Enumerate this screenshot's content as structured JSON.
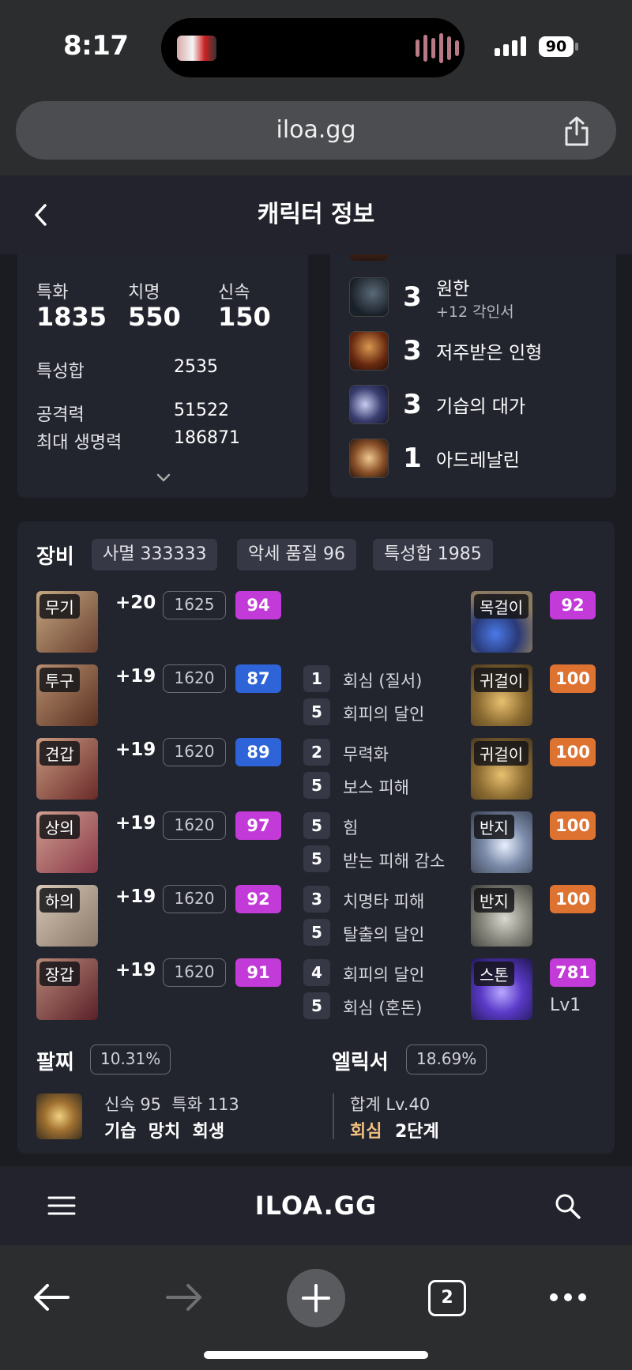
{
  "status": {
    "time": "8:17",
    "battery": "90"
  },
  "browser": {
    "url": "iloa.gg",
    "tab_count": "2"
  },
  "header": {
    "title": "캐릭터 정보"
  },
  "stats": {
    "primary": [
      {
        "label": "특화",
        "value": "1835"
      },
      {
        "label": "치명",
        "value": "550"
      },
      {
        "label": "신속",
        "value": "150"
      }
    ],
    "trait_sum_label": "특성합",
    "trait_sum": "2535",
    "attack_label": "공격력",
    "attack": "51522",
    "hp_label": "최대 생명력",
    "hp": "186871"
  },
  "engravings": [
    {
      "level": "3",
      "name": "원한",
      "sub": "+12 각인서",
      "icon": "grudge-icon"
    },
    {
      "level": "3",
      "name": "저주받은 인형",
      "icon": "cursed-doll-icon"
    },
    {
      "level": "3",
      "name": "기습의 대가",
      "icon": "master-ambush-icon"
    },
    {
      "level": "1",
      "name": "아드레날린",
      "icon": "adrenaline-icon"
    }
  ],
  "equipment": {
    "title": "장비",
    "chips": [
      "사멸 333333",
      "악세 품질 96",
      "특성합 1985"
    ],
    "gear": [
      {
        "slot": "무기",
        "refine": "+20",
        "ilvl": "1625",
        "quality": "94",
        "qcolor": "purple"
      },
      {
        "slot": "투구",
        "refine": "+19",
        "ilvl": "1620",
        "quality": "87",
        "qcolor": "blue"
      },
      {
        "slot": "견갑",
        "refine": "+19",
        "ilvl": "1620",
        "quality": "89",
        "qcolor": "blue"
      },
      {
        "slot": "상의",
        "refine": "+19",
        "ilvl": "1620",
        "quality": "97",
        "qcolor": "purple"
      },
      {
        "slot": "하의",
        "refine": "+19",
        "ilvl": "1620",
        "quality": "92",
        "qcolor": "purple"
      },
      {
        "slot": "장갑",
        "refine": "+19",
        "ilvl": "1620",
        "quality": "91",
        "qcolor": "purple"
      }
    ],
    "abilities": [
      [
        {
          "lv": "1",
          "name": "회심 (질서)"
        },
        {
          "lv": "5",
          "name": "회피의 달인"
        }
      ],
      [
        {
          "lv": "2",
          "name": "무력화"
        },
        {
          "lv": "5",
          "name": "보스 피해"
        }
      ],
      [
        {
          "lv": "5",
          "name": "힘"
        },
        {
          "lv": "5",
          "name": "받는 피해 감소"
        }
      ],
      [
        {
          "lv": "3",
          "name": "치명타 피해"
        },
        {
          "lv": "5",
          "name": "탈출의 달인"
        }
      ],
      [
        {
          "lv": "4",
          "name": "회피의 달인"
        },
        {
          "lv": "5",
          "name": "회심 (혼돈)"
        }
      ]
    ],
    "accessories": [
      {
        "slot": "목걸이",
        "quality": "92",
        "qcolor": "purple"
      },
      {
        "slot": "귀걸이",
        "quality": "100",
        "qcolor": "orange"
      },
      {
        "slot": "귀걸이",
        "quality": "100",
        "qcolor": "orange"
      },
      {
        "slot": "반지",
        "quality": "100",
        "qcolor": "orange"
      },
      {
        "slot": "반지",
        "quality": "100",
        "qcolor": "orange"
      },
      {
        "slot": "스톤",
        "quality": "781",
        "qcolor": "purple",
        "extra": "Lv1"
      }
    ]
  },
  "bracelet": {
    "title": "팔찌",
    "percent": "10.31%",
    "stats": "신속 95  특화 113",
    "effects": "기습  망치  회생"
  },
  "elixir": {
    "title": "엘릭서",
    "percent": "18.69%",
    "total": "합계 Lv.40",
    "set_name": "회심",
    "set_stage": "2단계"
  },
  "site": {
    "brand": "ILOA.GG"
  },
  "colors": {
    "purple": "#c23ad8",
    "blue": "#2f63d8",
    "orange": "#de7231",
    "gold": "#f0c080"
  }
}
